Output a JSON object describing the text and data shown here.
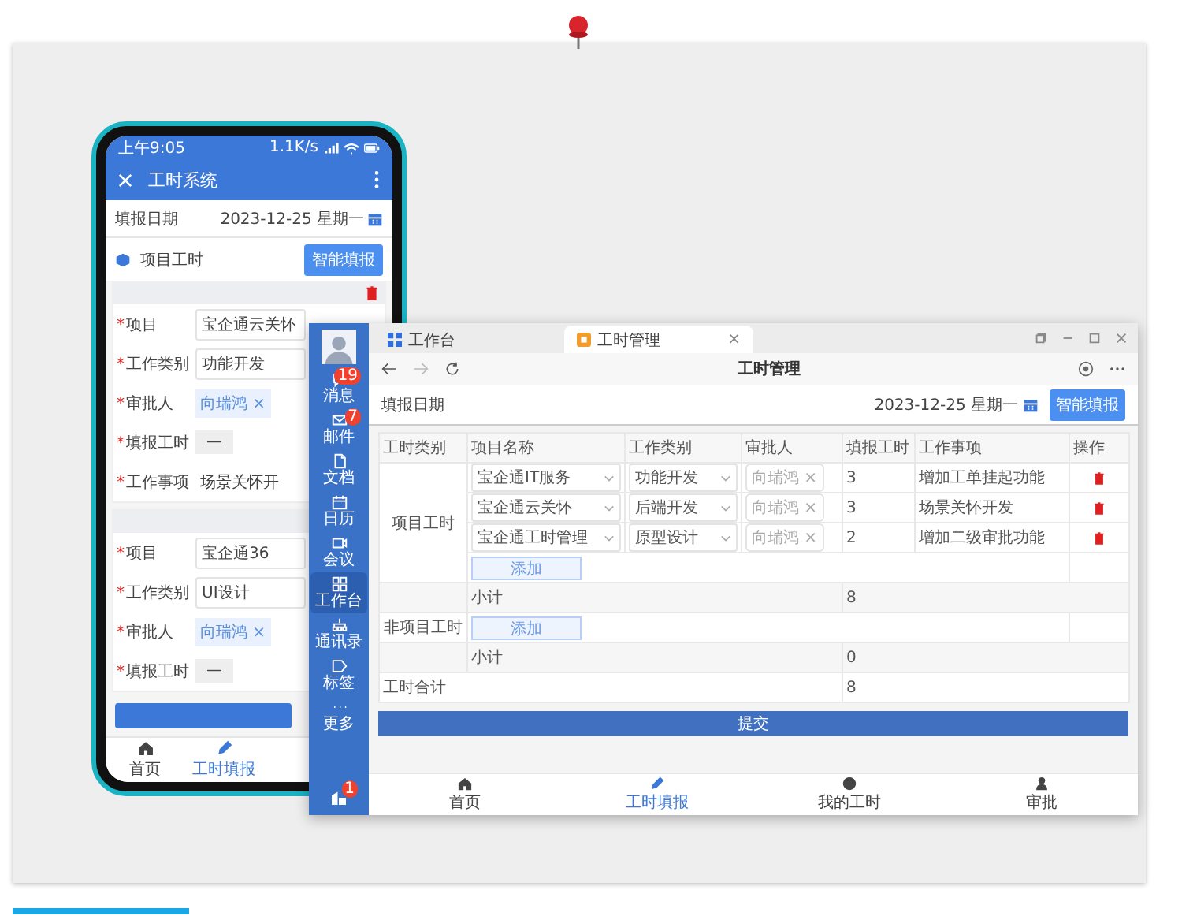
{
  "phone": {
    "status_time": "上午9:05",
    "net_speed": "1.1K/s",
    "title": "工时系统",
    "date_label": "填报日期",
    "date_value": "2023-12-25 星期一",
    "section_title": "项目工时",
    "smart_fill_button": "智能填报",
    "cards": [
      {
        "deletable": true,
        "fields": [
          {
            "kind": "select",
            "marker": "*",
            "label": "项目",
            "value": "宝企通云关怀"
          },
          {
            "kind": "select",
            "marker": "*",
            "label": "工作类别",
            "value": "功能开发"
          },
          {
            "kind": "tag",
            "marker": "*",
            "label": "审批人",
            "value": "向瑞鸿 ×"
          },
          {
            "kind": "stepper",
            "marker": "*",
            "label": "填报工时",
            "value": "—"
          },
          {
            "kind": "text",
            "marker": "*",
            "label": "工作事项",
            "value": "场景关怀开"
          }
        ]
      },
      {
        "fields": [
          {
            "kind": "select",
            "marker": "*",
            "label": "项目",
            "value": "宝企通36"
          },
          {
            "kind": "select",
            "marker": "*",
            "label": "工作类别",
            "value": "UI设计"
          },
          {
            "kind": "tag",
            "marker": "*",
            "label": "审批人",
            "value": "向瑞鸿 ×"
          },
          {
            "kind": "stepper",
            "marker": "*",
            "label": "填报工时",
            "value": "—"
          }
        ]
      }
    ],
    "nav": [
      {
        "label": "首页",
        "selected": false
      },
      {
        "label": "工时填报",
        "selected": true
      }
    ]
  },
  "desktop": {
    "sidebar": {
      "items": [
        {
          "label": "消息",
          "badge": "19",
          "selected": false
        },
        {
          "label": "邮件",
          "badge": "7",
          "selected": false
        },
        {
          "label": "文档",
          "selected": false
        },
        {
          "label": "日历",
          "selected": false
        },
        {
          "label": "会议",
          "selected": false
        },
        {
          "label": "工作台",
          "selected": true
        },
        {
          "label": "通讯录",
          "selected": false
        },
        {
          "label": "标签",
          "selected": false
        },
        {
          "label": "更多",
          "selected": false
        }
      ],
      "bottom_badge": "1"
    },
    "tabs": [
      {
        "label": "工作台",
        "selected": false
      },
      {
        "label": "工时管理",
        "selected": true,
        "close": "×"
      }
    ],
    "title": "工时管理",
    "date_label": "填报日期",
    "date_value": "2023-12-25 星期一",
    "smart_fill_button": "智能填报",
    "table": {
      "columns": [
        "工时类别",
        "项目名称",
        "工作类别",
        "审批人",
        "填报工时",
        "工作事项",
        "操作"
      ],
      "groups": [
        {
          "category": "项目工时",
          "rows": [
            {
              "project": "宝企通IT服务",
              "work_type": "功能开发",
              "approver": "向瑞鸿 ×",
              "hours": "3",
              "description": "增加工单挂起功能"
            },
            {
              "project": "宝企通云关怀",
              "work_type": "后端开发",
              "approver": "向瑞鸿 ×",
              "hours": "3",
              "description": "场景关怀开发"
            },
            {
              "project": "宝企通工时管理",
              "work_type": "原型设计",
              "approver": "向瑞鸿 ×",
              "hours": "2",
              "description": "增加二级审批功能"
            }
          ],
          "add_button": "添加",
          "subtotal_label": "小计",
          "subtotal": "8"
        },
        {
          "category": "非项目工时",
          "add_button": "添加",
          "subtotal_label": "小计",
          "subtotal": "0"
        }
      ],
      "total_label": "工时合计",
      "total": "8"
    },
    "submit_button": "提交",
    "nav": [
      {
        "label": "首页",
        "selected": false
      },
      {
        "label": "工时填报",
        "selected": true
      },
      {
        "label": "我的工时",
        "selected": false
      },
      {
        "label": "审批",
        "selected": false
      }
    ]
  }
}
